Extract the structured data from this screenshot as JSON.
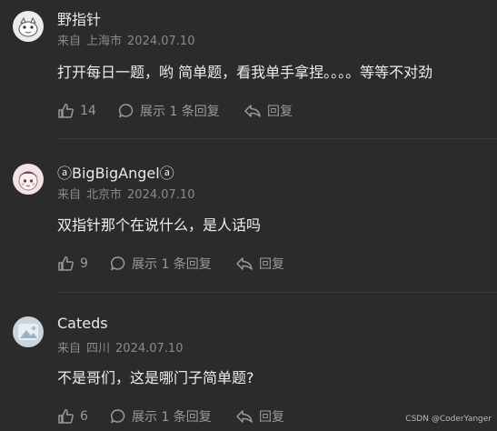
{
  "comments": [
    {
      "username": "野指针",
      "source_label": "来自",
      "location": "上海市",
      "date": "2024.07.10",
      "text": "打开每日一题，哟 简单题，看我单手拿捏。。。。等等不对劲",
      "likes": "14",
      "expand_label": "展示 1 条回复",
      "reply_label": "回复"
    },
    {
      "username": "ⓐBigBigAngelⓐ",
      "source_label": "来自",
      "location": "北京市",
      "date": "2024.07.10",
      "text": "双指针那个在说什么，是人话吗",
      "likes": "9",
      "expand_label": "展示 1 条回复",
      "reply_label": "回复"
    },
    {
      "username": "Cateds",
      "source_label": "来自",
      "location": "四川",
      "date": "2024.07.10",
      "text": "不是哥们，这是哪门子简单题?",
      "likes": "6",
      "expand_label": "展示 1 条回复",
      "reply_label": "回复"
    }
  ],
  "watermark": "CSDN @CoderYanger",
  "icons": {
    "like": "thumbs-up-icon",
    "expand": "speech-bubble-icon",
    "reply": "reply-arrow-icon"
  },
  "colors": {
    "background": "#2b2b2b",
    "text": "#ededed",
    "muted": "#8a8a8a"
  }
}
